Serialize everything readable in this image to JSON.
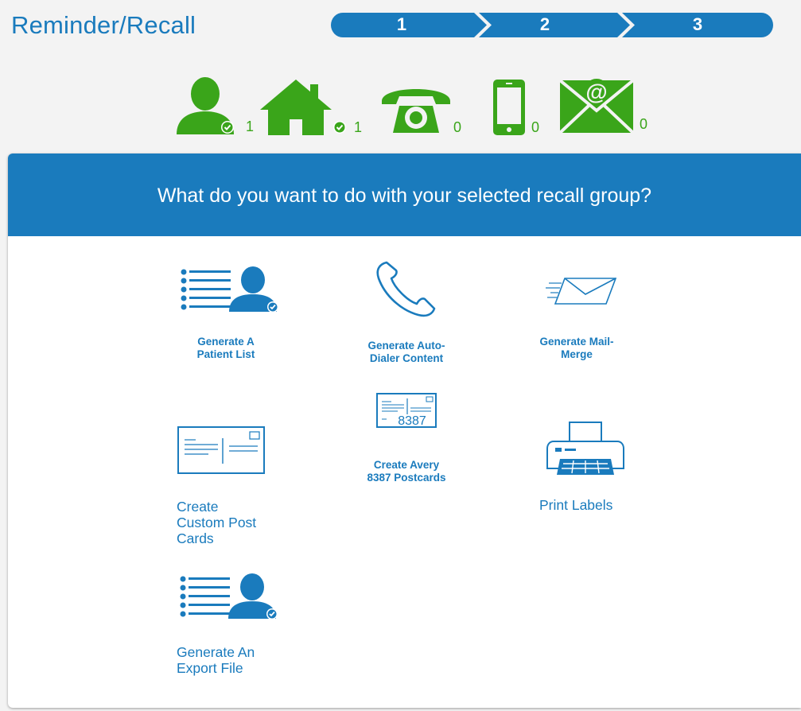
{
  "header": {
    "title": "Reminder/Recall",
    "steps": [
      "1",
      "2",
      "3"
    ]
  },
  "counts": [
    {
      "icon": "person-icon",
      "value": "1"
    },
    {
      "icon": "house-icon",
      "value": "1"
    },
    {
      "icon": "telephone-icon",
      "value": "0"
    },
    {
      "icon": "mobile-phone-icon",
      "value": "0"
    },
    {
      "icon": "email-icon",
      "value": "0"
    }
  ],
  "panel": {
    "question": "What do you want to do with your selected recall group?",
    "options": {
      "patient_list": {
        "line1": "Generate A",
        "line2": "Patient List"
      },
      "auto_dialer": {
        "line1": "Generate Auto-",
        "line2": "Dialer Content"
      },
      "mail_merge": {
        "line1": "Generate Mail-",
        "line2": "Merge"
      },
      "custom_post_cards": {
        "line1": "Create",
        "line2": "Custom Post",
        "line3": "Cards"
      },
      "avery": {
        "icon_text": "8387",
        "line1": "Create Avery",
        "line2": "8387 Postcards"
      },
      "print_labels": {
        "label": "Print Labels"
      },
      "export_file": {
        "line1": "Generate An",
        "line2": "Export File"
      }
    }
  },
  "colors": {
    "brand_blue": "#1a7bbd",
    "count_green": "#3aa51a",
    "background": "#f3f3f3"
  }
}
